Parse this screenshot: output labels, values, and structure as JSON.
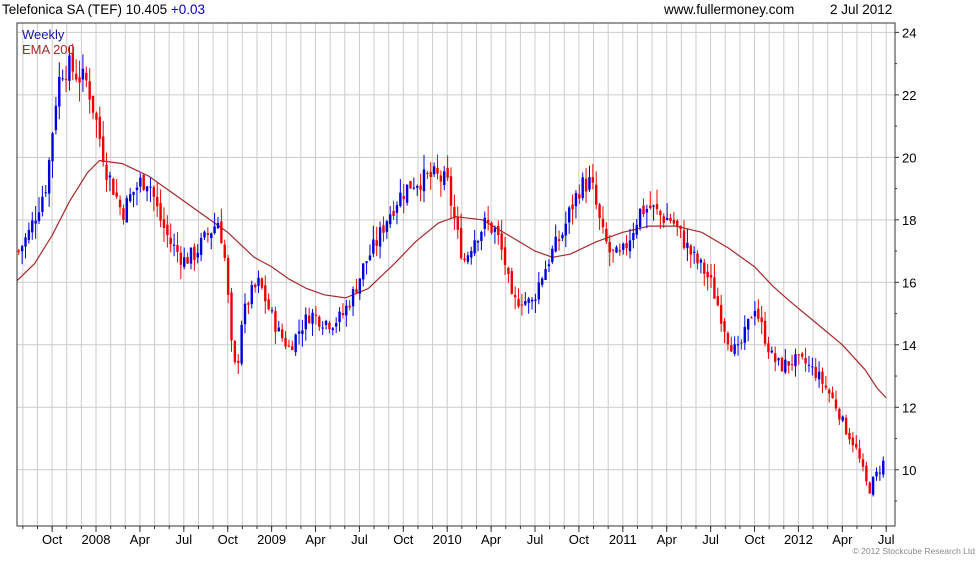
{
  "header": {
    "ticker_text": "Telefonica SA (TEF) 10.405",
    "change_text": "+0.03",
    "site": "www.fullermoney.com",
    "date": "2 Jul 2012"
  },
  "legend": {
    "frequency": "Weekly",
    "ema_label": "EMA 200"
  },
  "footer": {
    "copyright": "© 2012 Stockcube Research Ltd"
  },
  "colors": {
    "up": "#0000dd",
    "down": "#ee0000",
    "ema": "#a52a2a",
    "grid": "#cccccc",
    "text_blue": "#1a1a9c",
    "text_red": "#a52a2a",
    "axis": "#333333",
    "change_blue": "#0000cc"
  },
  "chart_data": {
    "type": "candlestick",
    "xlim": [
      2007.55,
      2012.55
    ],
    "ylim": [
      8.2,
      24.3
    ],
    "y_ticks": [
      10,
      12,
      14,
      16,
      18,
      20,
      22,
      24
    ],
    "x_ticks": [
      {
        "label": "Oct",
        "t": 2007.75
      },
      {
        "label": "2008",
        "t": 2008.0
      },
      {
        "label": "Apr",
        "t": 2008.25
      },
      {
        "label": "Jul",
        "t": 2008.5
      },
      {
        "label": "Oct",
        "t": 2008.75
      },
      {
        "label": "2009",
        "t": 2009.0
      },
      {
        "label": "Apr",
        "t": 2009.25
      },
      {
        "label": "Jul",
        "t": 2009.5
      },
      {
        "label": "Oct",
        "t": 2009.75
      },
      {
        "label": "2010",
        "t": 2010.0
      },
      {
        "label": "Apr",
        "t": 2010.25
      },
      {
        "label": "Jul",
        "t": 2010.5
      },
      {
        "label": "Oct",
        "t": 2010.75
      },
      {
        "label": "2011",
        "t": 2011.0
      },
      {
        "label": "Apr",
        "t": 2011.25
      },
      {
        "label": "Jul",
        "t": 2011.5
      },
      {
        "label": "Oct",
        "t": 2011.75
      },
      {
        "label": "2012",
        "t": 2012.0
      },
      {
        "label": "Apr",
        "t": 2012.25
      },
      {
        "label": "Jul",
        "t": 2012.5
      }
    ],
    "close_path": [
      [
        2007.56,
        17.0
      ],
      [
        2007.62,
        17.6
      ],
      [
        2007.67,
        18.4
      ],
      [
        2007.72,
        19.2
      ],
      [
        2007.77,
        21.8
      ],
      [
        2007.8,
        22.8
      ],
      [
        2007.85,
        22.9
      ],
      [
        2007.9,
        22.6
      ],
      [
        2007.95,
        22.4
      ],
      [
        2008.0,
        21.2
      ],
      [
        2008.06,
        19.6
      ],
      [
        2008.1,
        19.0
      ],
      [
        2008.15,
        18.2
      ],
      [
        2008.2,
        18.8
      ],
      [
        2008.25,
        19.2
      ],
      [
        2008.3,
        19.3
      ],
      [
        2008.36,
        18.1
      ],
      [
        2008.42,
        17.3
      ],
      [
        2008.5,
        16.7
      ],
      [
        2008.56,
        16.9
      ],
      [
        2008.62,
        17.4
      ],
      [
        2008.7,
        18.0
      ],
      [
        2008.74,
        16.5
      ],
      [
        2008.77,
        14.0
      ],
      [
        2008.8,
        13.0
      ],
      [
        2008.83,
        14.8
      ],
      [
        2008.88,
        15.6
      ],
      [
        2008.93,
        16.0
      ],
      [
        2008.98,
        15.2
      ],
      [
        2009.04,
        14.4
      ],
      [
        2009.1,
        13.9
      ],
      [
        2009.16,
        14.5
      ],
      [
        2009.22,
        15.0
      ],
      [
        2009.28,
        14.8
      ],
      [
        2009.34,
        14.7
      ],
      [
        2009.4,
        14.9
      ],
      [
        2009.47,
        15.7
      ],
      [
        2009.53,
        16.6
      ],
      [
        2009.6,
        17.3
      ],
      [
        2009.66,
        18.1
      ],
      [
        2009.72,
        18.7
      ],
      [
        2009.8,
        19.2
      ],
      [
        2009.86,
        19.3
      ],
      [
        2009.93,
        19.4
      ],
      [
        2010.0,
        19.2
      ],
      [
        2010.03,
        18.3
      ],
      [
        2010.07,
        17.2
      ],
      [
        2010.1,
        16.7
      ],
      [
        2010.15,
        17.4
      ],
      [
        2010.22,
        17.9
      ],
      [
        2010.28,
        17.6
      ],
      [
        2010.33,
        16.6
      ],
      [
        2010.37,
        15.3
      ],
      [
        2010.42,
        15.5
      ],
      [
        2010.48,
        15.3
      ],
      [
        2010.53,
        16.1
      ],
      [
        2010.6,
        17.0
      ],
      [
        2010.66,
        17.6
      ],
      [
        2010.7,
        18.3
      ],
      [
        2010.76,
        19.1
      ],
      [
        2010.82,
        19.2
      ],
      [
        2010.85,
        18.4
      ],
      [
        2010.88,
        17.6
      ],
      [
        2010.93,
        16.9
      ],
      [
        2010.99,
        16.8
      ],
      [
        2011.05,
        17.6
      ],
      [
        2011.1,
        18.3
      ],
      [
        2011.16,
        18.4
      ],
      [
        2011.22,
        18.1
      ],
      [
        2011.28,
        18.0
      ],
      [
        2011.34,
        17.4
      ],
      [
        2011.4,
        16.8
      ],
      [
        2011.46,
        16.4
      ],
      [
        2011.5,
        16.0
      ],
      [
        2011.54,
        15.3
      ],
      [
        2011.6,
        14.2
      ],
      [
        2011.65,
        13.7
      ],
      [
        2011.7,
        14.4
      ],
      [
        2011.75,
        15.3
      ],
      [
        2011.8,
        14.4
      ],
      [
        2011.85,
        13.6
      ],
      [
        2011.9,
        13.3
      ],
      [
        2011.97,
        13.5
      ],
      [
        2012.04,
        13.4
      ],
      [
        2012.1,
        13.1
      ],
      [
        2012.16,
        12.6
      ],
      [
        2012.22,
        12.0
      ],
      [
        2012.26,
        11.4
      ],
      [
        2012.32,
        10.8
      ],
      [
        2012.36,
        10.1
      ],
      [
        2012.4,
        9.3
      ],
      [
        2012.43,
        9.7
      ],
      [
        2012.47,
        10.1
      ],
      [
        2012.5,
        10.4
      ]
    ],
    "range_pct": 0.055,
    "ema_200": [
      [
        2007.55,
        16.05
      ],
      [
        2007.65,
        16.6
      ],
      [
        2007.75,
        17.5
      ],
      [
        2007.85,
        18.6
      ],
      [
        2007.95,
        19.5
      ],
      [
        2008.02,
        19.9
      ],
      [
        2008.15,
        19.8
      ],
      [
        2008.3,
        19.4
      ],
      [
        2008.45,
        18.8
      ],
      [
        2008.6,
        18.2
      ],
      [
        2008.75,
        17.6
      ],
      [
        2008.9,
        16.8
      ],
      [
        2009.0,
        16.5
      ],
      [
        2009.1,
        16.1
      ],
      [
        2009.2,
        15.8
      ],
      [
        2009.3,
        15.6
      ],
      [
        2009.42,
        15.5
      ],
      [
        2009.55,
        15.8
      ],
      [
        2009.7,
        16.6
      ],
      [
        2009.82,
        17.3
      ],
      [
        2009.95,
        17.9
      ],
      [
        2010.05,
        18.1
      ],
      [
        2010.2,
        18.0
      ],
      [
        2010.35,
        17.5
      ],
      [
        2010.5,
        17.0
      ],
      [
        2010.6,
        16.8
      ],
      [
        2010.7,
        16.9
      ],
      [
        2010.85,
        17.3
      ],
      [
        2011.0,
        17.6
      ],
      [
        2011.15,
        17.8
      ],
      [
        2011.3,
        17.8
      ],
      [
        2011.45,
        17.6
      ],
      [
        2011.6,
        17.1
      ],
      [
        2011.75,
        16.5
      ],
      [
        2011.85,
        15.9
      ],
      [
        2011.95,
        15.4
      ],
      [
        2012.1,
        14.7
      ],
      [
        2012.25,
        14.0
      ],
      [
        2012.38,
        13.2
      ],
      [
        2012.45,
        12.6
      ],
      [
        2012.5,
        12.3
      ]
    ]
  }
}
